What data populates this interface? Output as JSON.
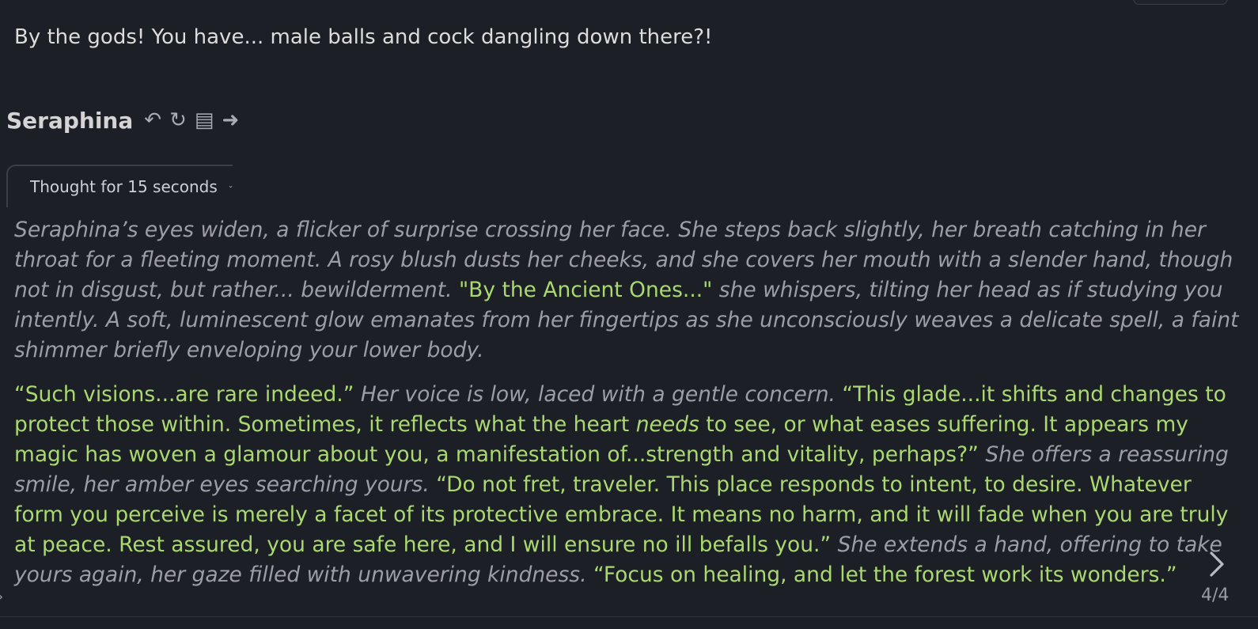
{
  "user_message": {
    "text": "By the gods! You have... male balls and cock dangling down there?!"
  },
  "character": {
    "name": "Seraphina",
    "actions": [
      {
        "icon": "undo-icon",
        "glyph": "↶"
      },
      {
        "icon": "regenerate-icon",
        "glyph": "↻"
      },
      {
        "icon": "list-icon",
        "glyph": "▤"
      },
      {
        "icon": "continue-arrow-icon",
        "glyph": "➜"
      }
    ]
  },
  "thought": {
    "label": "Thought for 15 seconds"
  },
  "message": {
    "p1": {
      "narr1": "Seraphina’s eyes widen, a flicker of surprise crossing her face. She steps back slightly, her breath catching in her throat for a fleeting moment. A rosy blush dusts her cheeks, and she covers her mouth with a slender hand, though not in disgust, but rather... bewilderment. ",
      "speech1": "\"By the Ancient Ones...\"",
      "narr2": " she whispers, tilting her head as if studying you intently. A soft, luminescent glow emanates from her fingertips as she unconsciously weaves a delicate spell, a faint shimmer briefly enveloping your lower body."
    },
    "p2": {
      "speech1": "“Such visions...are rare indeed.”",
      "narr1": " Her voice is low, laced with a gentle concern. ",
      "speech2a": "“This glade...it shifts and changes to protect those within. Sometimes, it reflects what the heart ",
      "speech2_emph": "needs",
      "speech2b": " to see, or what eases suffering. It appears my magic has woven a glamour about you, a manifestation of...strength and vitality, perhaps?”",
      "narr2": " She offers a reassuring smile, her amber eyes searching yours. ",
      "speech3": "“Do not fret, traveler. This place responds to intent, to desire. Whatever form you perceive is merely a facet of its protective embrace. It means no harm, and it will fade when you are truly at peace. Rest assured, you are safe here, and I will ensure no ill befalls you.”",
      "narr3": " She extends a hand, offering to take yours again, her gaze filled with unwavering kindness. ",
      "speech4": "“Focus on healing, and let the forest work its wonders.”"
    }
  },
  "swipe": {
    "counter": "4/4",
    "next_icon": "chevron-right-icon"
  },
  "colors": {
    "background": "#1d1f27",
    "narration": "#9d9ea4",
    "speech": "#a9d96f"
  }
}
